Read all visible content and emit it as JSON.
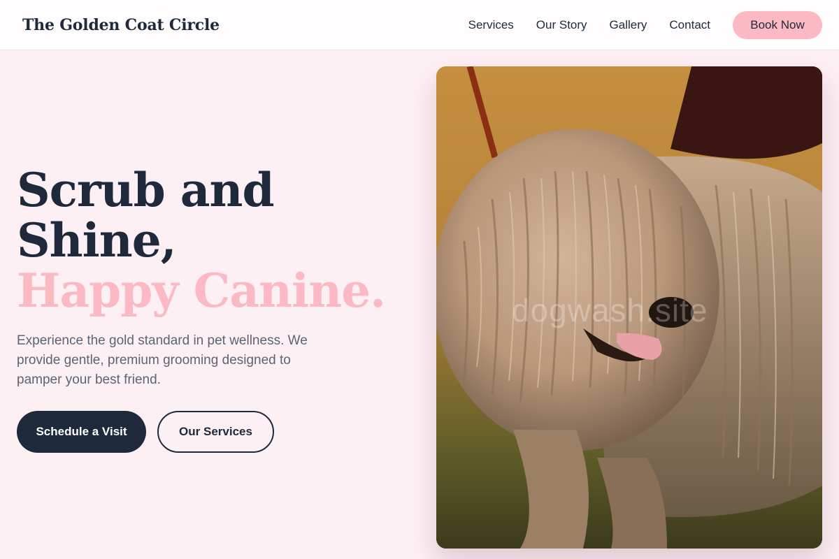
{
  "header": {
    "brand": "The Golden Coat Circle",
    "nav": [
      "Services",
      "Our Story",
      "Gallery",
      "Contact"
    ],
    "cta": "Book Now"
  },
  "hero": {
    "title_line1": "Scrub and",
    "title_line2": "Shine,",
    "title_line3": "Happy Canine.",
    "description": "Experience the gold standard in pet wellness. We provide gentle, premium grooming designed to pamper your best friend.",
    "primary_button": "Schedule a Visit",
    "secondary_button": "Our Services"
  },
  "image": {
    "watermark": "dogwash.site",
    "subject": "long-corded-dog-photo"
  },
  "colors": {
    "navy": "#1e293b",
    "pink": "#fbb9c3",
    "background": "#fdf0f4"
  }
}
